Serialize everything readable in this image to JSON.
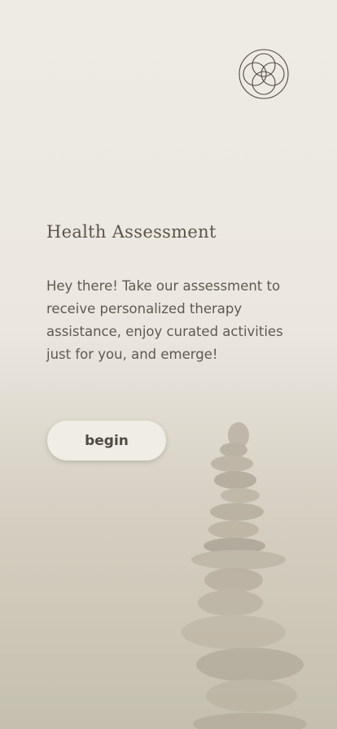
{
  "logo": {
    "icon": "flower-of-life-icon"
  },
  "header": {
    "title": "Health Assessment"
  },
  "main": {
    "description": "Hey there! Take our assessment to receive personalized therapy assistance, enjoy curated activities just for you, and emerge!",
    "begin_label": "begin"
  },
  "background": {
    "image": "stacked-stones-cairn"
  },
  "colors": {
    "background": "#eeebe5",
    "title": "#5c5446",
    "text": "#5f5a4f",
    "button_bg": "#f0ede6",
    "button_text": "#4f4b40"
  }
}
